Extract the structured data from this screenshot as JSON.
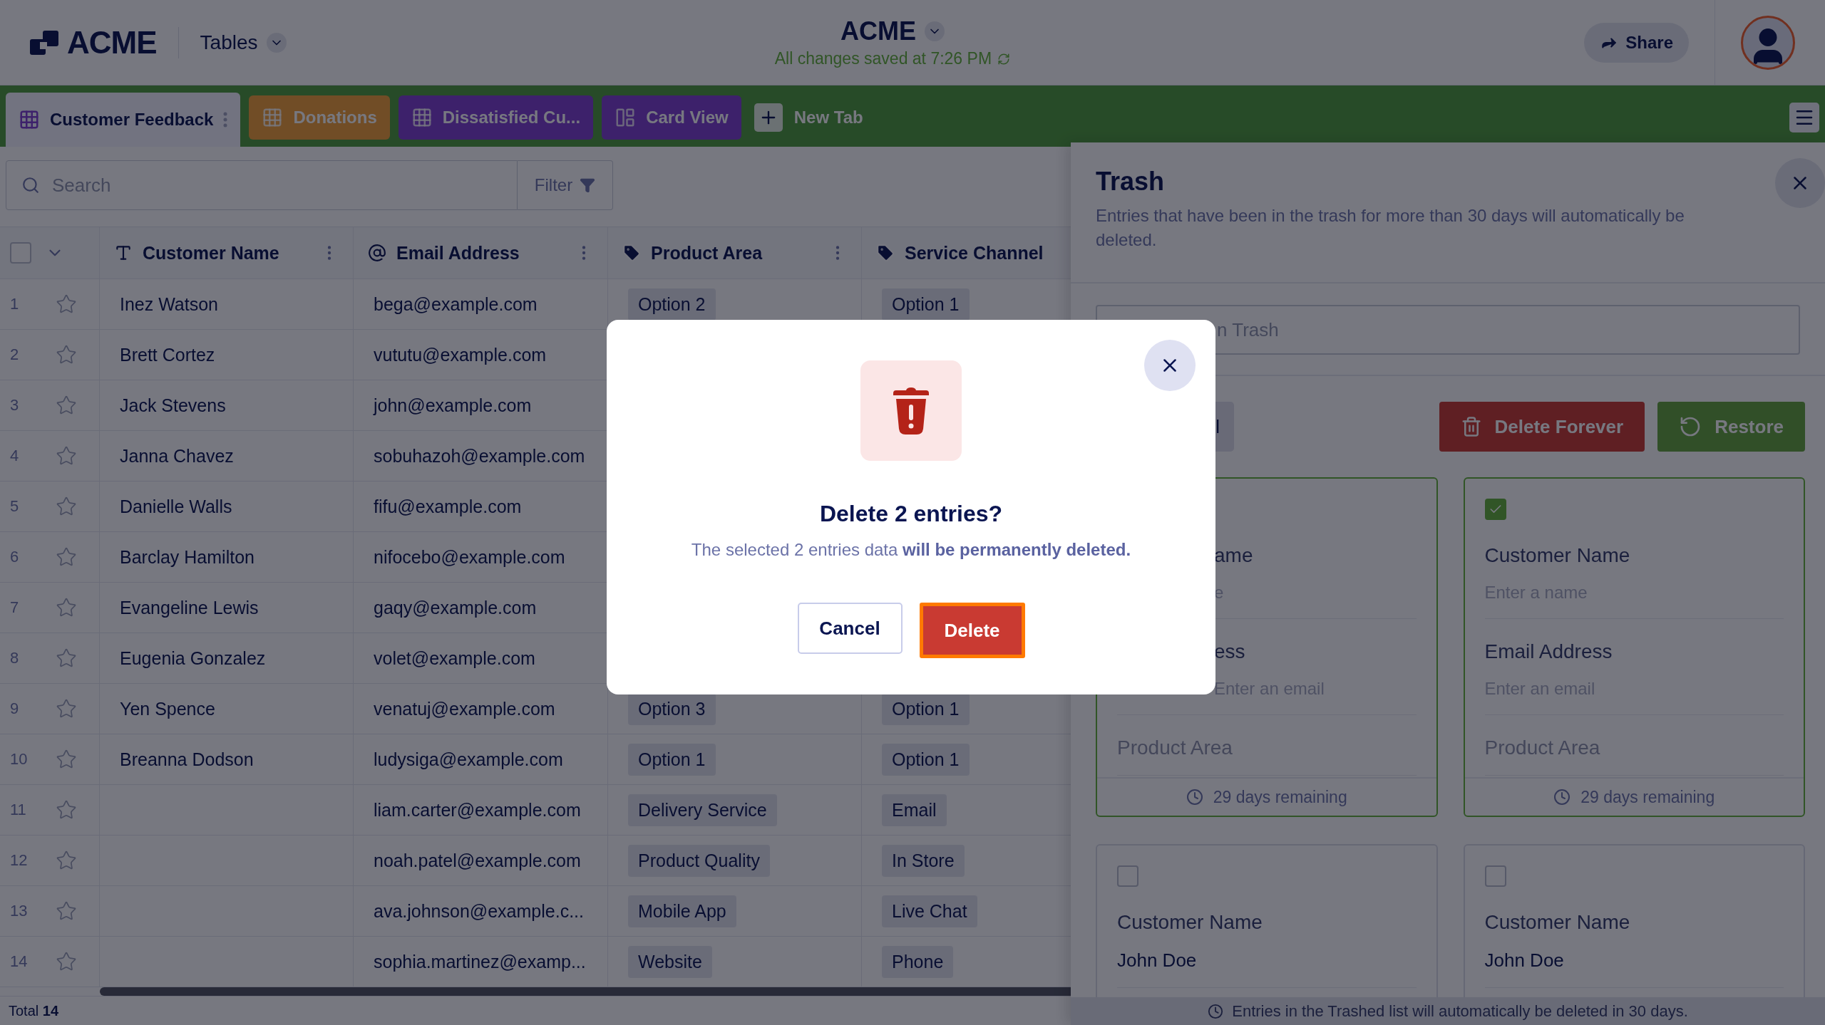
{
  "header": {
    "logo": "ACME",
    "tables_menu": "Tables",
    "title": "ACME",
    "save_status": "All changes saved at 7:26 PM",
    "share": "Share"
  },
  "tabs": [
    {
      "label": "Customer Feedback",
      "kind": "table",
      "selected": true,
      "color": "#727380"
    },
    {
      "label": "Donations",
      "kind": "table",
      "selected": false,
      "color": "#714e27"
    },
    {
      "label": "Dissatisfied Cu...",
      "kind": "table",
      "selected": false,
      "color": "#3d226b"
    },
    {
      "label": "Card View",
      "kind": "cards",
      "selected": false,
      "color": "#3d226b"
    }
  ],
  "new_tab": "New Tab",
  "search": {
    "placeholder": "Search"
  },
  "filter": "Filter",
  "select_all": {
    "checked": false
  },
  "columns": [
    {
      "label": "Customer Name",
      "kind": "text",
      "menu": true
    },
    {
      "label": "Email Address",
      "kind": "email",
      "menu": true
    },
    {
      "label": "Product Area",
      "kind": "tag",
      "menu": true
    },
    {
      "label": "Service Channel",
      "kind": "tag"
    }
  ],
  "rows": [
    {
      "number": "1",
      "starred": false,
      "name": "Inez Watson",
      "email": "bega@example.com",
      "product": "Option 2",
      "channel": "Option 1"
    },
    {
      "number": "2",
      "starred": false,
      "name": "Brett Cortez",
      "email": "vututu@example.com"
    },
    {
      "number": "3",
      "starred": false,
      "name": "Jack Stevens",
      "email": "john@example.com"
    },
    {
      "number": "4",
      "starred": false,
      "name": "Janna Chavez",
      "email": "sobuhazoh@example.com"
    },
    {
      "number": "5",
      "starred": false,
      "name": "Danielle Walls",
      "email": "fifu@example.com"
    },
    {
      "number": "6",
      "starred": false,
      "name": "Barclay Hamilton",
      "email": "nifocebo@example.com"
    },
    {
      "number": "7",
      "starred": false,
      "name": "Evangeline Lewis",
      "email": "gaqy@example.com"
    },
    {
      "number": "8",
      "starred": false,
      "name": "Eugenia Gonzalez",
      "email": "volet@example.com"
    },
    {
      "number": "9",
      "starred": false,
      "name": "Yen Spence",
      "email": "venatuj@example.com",
      "product": "Option 3",
      "channel": "Option 1"
    },
    {
      "number": "10",
      "starred": false,
      "name": "Breanna Dodson",
      "email": "ludysiga@example.com",
      "product": "Option 1",
      "channel": "Option 1"
    },
    {
      "number": "11",
      "starred": false,
      "email": "liam.carter@example.com",
      "product": "Delivery Service",
      "channel": "Email"
    },
    {
      "number": "12",
      "starred": false,
      "email": "noah.patel@example.com",
      "product": "Product Quality",
      "channel": "In Store"
    },
    {
      "number": "13",
      "starred": false,
      "email": "ava.johnson@example.c...",
      "product": "Mobile App",
      "channel": "Live Chat"
    },
    {
      "number": "14",
      "starred": false,
      "email": "sophia.martinez@examp...",
      "product": "Website",
      "channel": "Phone"
    }
  ],
  "total": {
    "label": "Total",
    "count": "14"
  },
  "trash": {
    "title": "Trash",
    "description": "Entries that have been in the trash for more than 30 days will automatically be deleted.",
    "search": {
      "placeholder": "n Trash"
    },
    "select_button": "l",
    "delete_forever": "Delete Forever",
    "restore": "Restore",
    "cards": [
      {
        "selected": true,
        "fields": [
          {
            "label": "ame",
            "placeholder": "e",
            "covered": true
          },
          {
            "label": "ess",
            "placeholder": "Enter an email",
            "covered": true
          },
          {
            "label": "Product Area",
            "faded": true
          }
        ],
        "remaining": "29 days remaining"
      },
      {
        "selected": true,
        "checked": true,
        "fields": [
          {
            "label": "Customer Name",
            "placeholder": "Enter a name"
          },
          {
            "label": "Email Address",
            "placeholder": "Enter an email"
          },
          {
            "label": "Product Area",
            "faded": true
          }
        ],
        "remaining": "29 days remaining"
      },
      {
        "selected": false,
        "checked": false,
        "fields": [
          {
            "label": "Customer Name",
            "value": "John Doe"
          }
        ]
      },
      {
        "selected": false,
        "checked": false,
        "fields": [
          {
            "label": "Customer Name",
            "value": "John Doe"
          }
        ]
      }
    ],
    "footer_note": "Entries in the Trashed list will automatically be deleted in 30 days."
  },
  "modal": {
    "title": "Delete 2 entries?",
    "message": "The selected 2 entries data **will be permanently deleted.**",
    "cancel": "Cancel",
    "confirm": "Delete",
    "confirm_focused": true
  }
}
